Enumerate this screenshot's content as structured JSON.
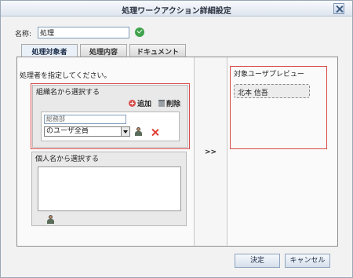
{
  "dialog": {
    "title": "処理ワークアクション詳細設定"
  },
  "name": {
    "label": "名称:",
    "value": "処理"
  },
  "tabs": [
    {
      "label": "処理対象者",
      "active": true
    },
    {
      "label": "処理内容",
      "active": false
    },
    {
      "label": "ドキュメント",
      "active": false
    }
  ],
  "left": {
    "instruction": "処理者を指定してください。",
    "org_group": {
      "title": "組織名から選択する",
      "add_label": "追加",
      "delete_label": "削除",
      "org_field_value": "総務部",
      "select_value": "のユーザ全員"
    },
    "person_group": {
      "title": "個人名から選択する"
    }
  },
  "middle": {
    "arrow": ">>"
  },
  "preview": {
    "title": "対象ユーザプレビュー",
    "users": [
      "北本 信吾"
    ]
  },
  "buttons": {
    "ok": "決定",
    "cancel": "キャンセル"
  },
  "colors": {
    "highlight_border": "#d94a4a",
    "ok_icon": "#3fa34d",
    "delete_icon": "#e03c31"
  }
}
